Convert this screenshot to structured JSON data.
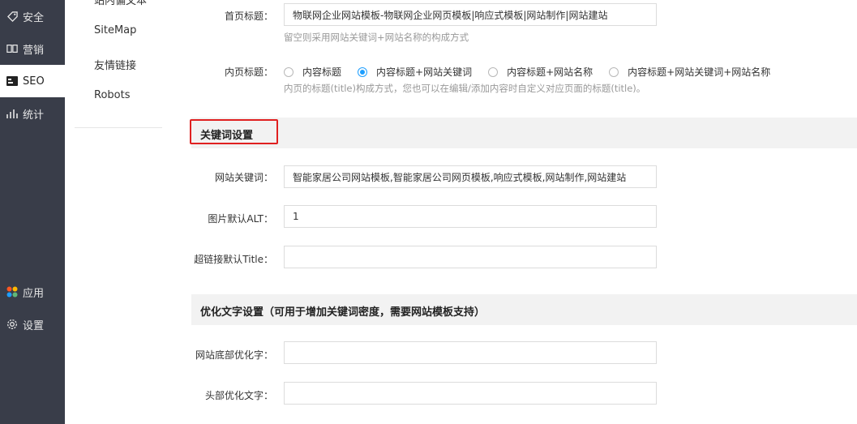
{
  "nav": {
    "items": [
      {
        "label": "安全",
        "icon": "tag-icon"
      },
      {
        "label": "营销",
        "icon": "book-icon"
      },
      {
        "label": "SEO",
        "icon": "seo-card-icon",
        "active": true
      },
      {
        "label": "统计",
        "icon": "bar-chart-icon"
      },
      {
        "label": "应用",
        "icon": "apps-icon"
      },
      {
        "label": "设置",
        "icon": "gear-icon"
      }
    ]
  },
  "submenu": {
    "items": [
      "站内偏文本",
      "SiteMap",
      "友情链接",
      "Robots"
    ]
  },
  "form": {
    "home_title_label": "首页标题：",
    "home_title_value": "物联网企业网站模板-物联网企业网页模板|响应式模板|网站制作|网站建站",
    "home_title_hint": "留空则采用网站关键词+网站名称的构成方式",
    "inner_title_label": "内页标题：",
    "inner_title_options": [
      "内容标题",
      "内容标题+网站关键词",
      "内容标题+网站名称",
      "内容标题+网站关键词+网站名称"
    ],
    "inner_title_selected": 1,
    "inner_title_hint": "内页的标题(title)构成方式，您也可以在编辑/添加内容时自定义对应页面的标题(title)。"
  },
  "keywords_section": {
    "title": "关键词设置",
    "site_keywords_label": "网站关键词：",
    "site_keywords_value": "智能家居公司网站模板,智能家居公司网页模板,响应式模板,网站制作,网站建站",
    "img_alt_label": "图片默认ALT：",
    "img_alt_value": "1",
    "link_title_label": "超链接默认Title：",
    "link_title_value": ""
  },
  "optimize_section": {
    "title": "优化文字设置（可用于增加关键词密度，需要网站模板支持）",
    "footer_text_label": "网站底部优化字：",
    "footer_text_value": "",
    "header_text_label": "头部优化文字：",
    "header_text_value": ""
  },
  "colors": {
    "nav_bg": "#393d49",
    "accent": "#1e9fff",
    "highlight": "#e02020"
  }
}
